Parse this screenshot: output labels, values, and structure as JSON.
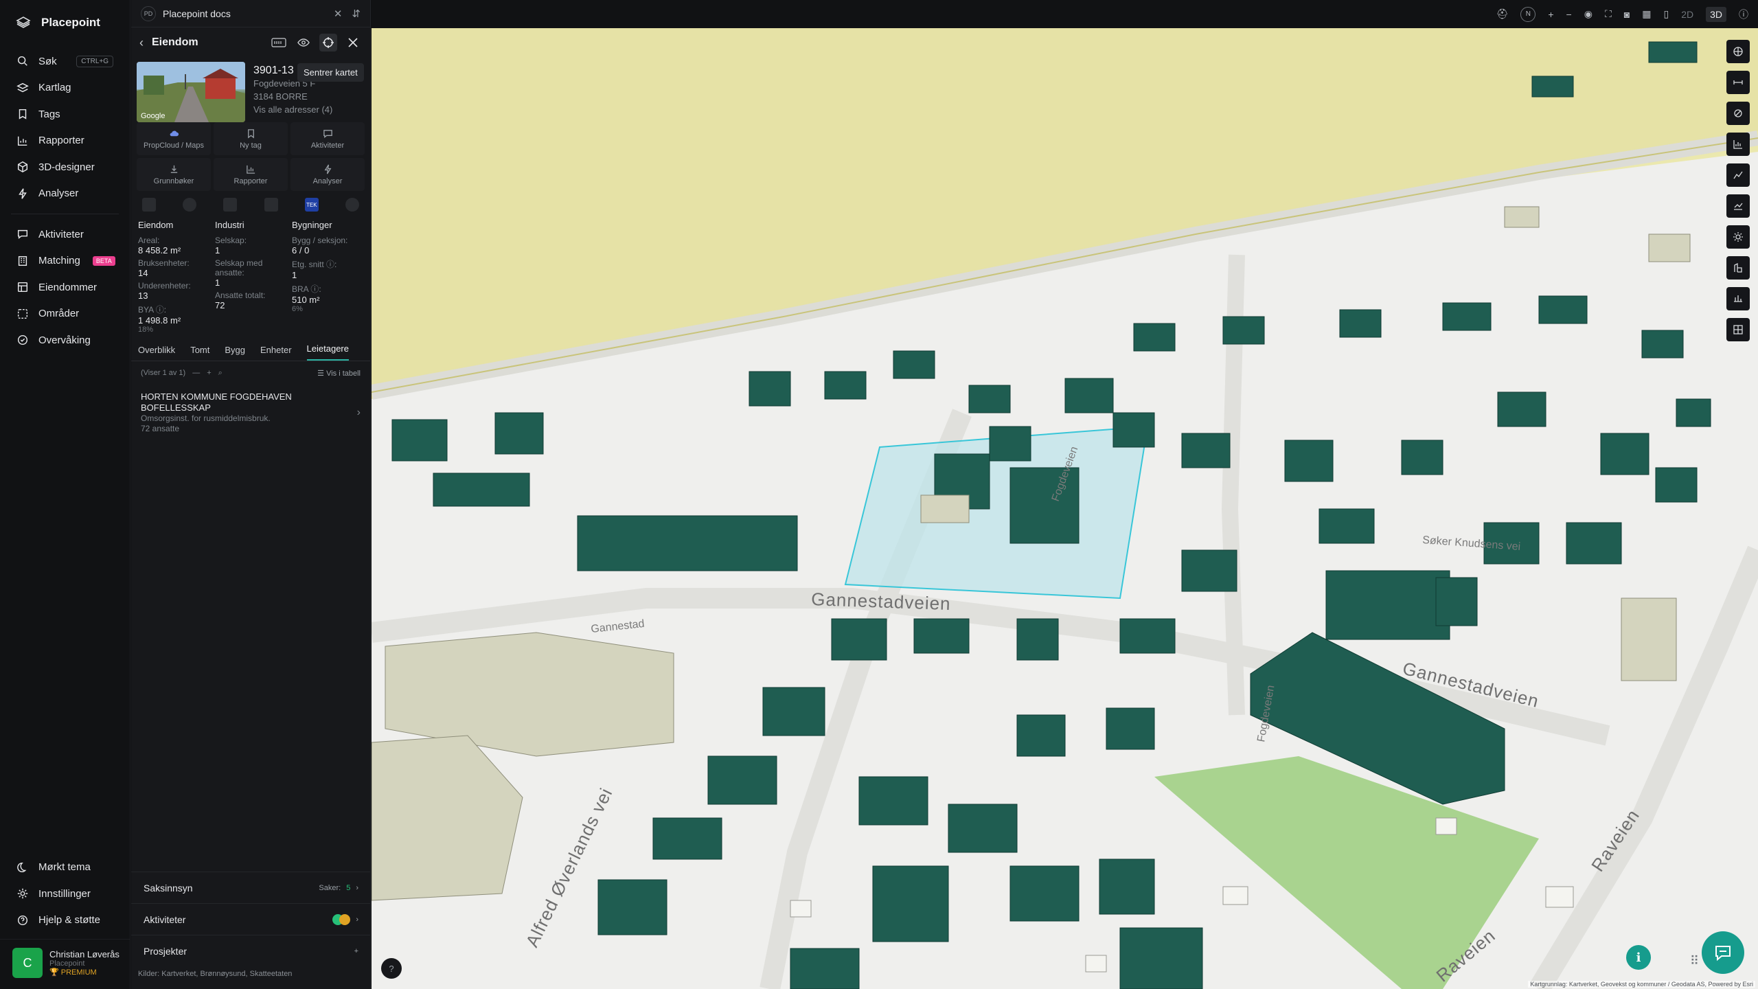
{
  "app": {
    "name": "Placepoint"
  },
  "nav": {
    "items": [
      {
        "label": "Søk",
        "kbd": "CTRL+G"
      },
      {
        "label": "Kartlag"
      },
      {
        "label": "Tags"
      },
      {
        "label": "Rapporter"
      },
      {
        "label": "3D-designer"
      },
      {
        "label": "Analyser"
      },
      {
        "label": "Aktiviteter"
      },
      {
        "label": "Matching",
        "badge": "BETA"
      },
      {
        "label": "Eiendommer"
      },
      {
        "label": "Områder"
      },
      {
        "label": "Overvåking"
      }
    ],
    "bottom": [
      {
        "label": "Mørkt tema"
      },
      {
        "label": "Innstillinger"
      },
      {
        "label": "Hjelp & støtte"
      }
    ],
    "user": {
      "initial": "C",
      "name": "Christian Løverås",
      "org": "Placepoint",
      "plan": "PREMIUM"
    }
  },
  "panel": {
    "workspace_badge": "PD",
    "workspace": "Placepoint docs",
    "header": "Eiendom",
    "tooltip": "Sentrer kartet",
    "property": {
      "id": "3901-13",
      "address": "Fogdeveien 5 F",
      "city": "3184 BORRE",
      "all_addresses": "Vis alle adresser (4)",
      "photo_credit": "Google"
    },
    "actions": [
      {
        "label": "PropCloud / Maps"
      },
      {
        "label": "Ny tag"
      },
      {
        "label": "Aktiviteter"
      },
      {
        "label": "Grunnbøker"
      },
      {
        "label": "Rapporter"
      },
      {
        "label": "Analyser"
      }
    ],
    "source_tek": "TEK",
    "stats": {
      "eiendom": {
        "heading": "Eiendom",
        "areal_label": "Areal:",
        "areal": "8 458.2 m²",
        "bruksenheter_label": "Bruksenheter:",
        "bruksenheter": "14",
        "underenheter_label": "Underenheter:",
        "underenheter": "13",
        "bya_label": "BYA ⓘ:",
        "bya": "1 498.8 m²",
        "bya_pct": "18%"
      },
      "industri": {
        "heading": "Industri",
        "selskap_label": "Selskap:",
        "selskap": "1",
        "ansatte_sel_label": "Selskap med ansatte:",
        "ansatte_sel": "1",
        "ansatte_tot_label": "Ansatte totalt:",
        "ansatte_tot": "72"
      },
      "bygninger": {
        "heading": "Bygninger",
        "bygg_label": "Bygg / seksjon:",
        "bygg": "6 / 0",
        "etg_label": "Etg. snitt ⓘ:",
        "etg": "1",
        "bra_label": "BRA ⓘ:",
        "bra": "510 m²",
        "bra_pct": "6%"
      }
    },
    "tabs": [
      "Overblikk",
      "Tomt",
      "Bygg",
      "Enheter",
      "Leietagere"
    ],
    "active_tab": "Leietagere",
    "list": {
      "showing": "(Viser 1 av 1)",
      "table_link": "Vis i tabell",
      "tenant": {
        "name": "HORTEN KOMMUNE FOGDEHAVEN BOFELLESSKAP",
        "desc": "Omsorgsinst. for rusmiddelmisbruk.",
        "employees": "72 ansatte"
      }
    },
    "accordions": [
      {
        "label": "Saksinnsyn",
        "meta": "Saker:",
        "count": "5"
      },
      {
        "label": "Aktiviteter"
      },
      {
        "label": "Prosjekter",
        "meta": "+"
      }
    ],
    "sources_label": "Kilder:",
    "sources": [
      "Kartverket,",
      "Brønnøysund,",
      "Skatteetaten"
    ]
  },
  "map": {
    "view_2d": "2D",
    "view_3d": "3D",
    "compass": "N",
    "roads": [
      "Gannestadveien",
      "Gannestadveien",
      "Alfred Øverlands vei",
      "Fogdeveien",
      "Raveien",
      "Raveien",
      "Gannestad",
      "Fogdeveien",
      "Søker Knudsens vei"
    ],
    "attribution": "Kartgrunnlag: Kartverket, Geovekst og kommuner / Geodata AS, Powered by Esri",
    "help": "?"
  }
}
